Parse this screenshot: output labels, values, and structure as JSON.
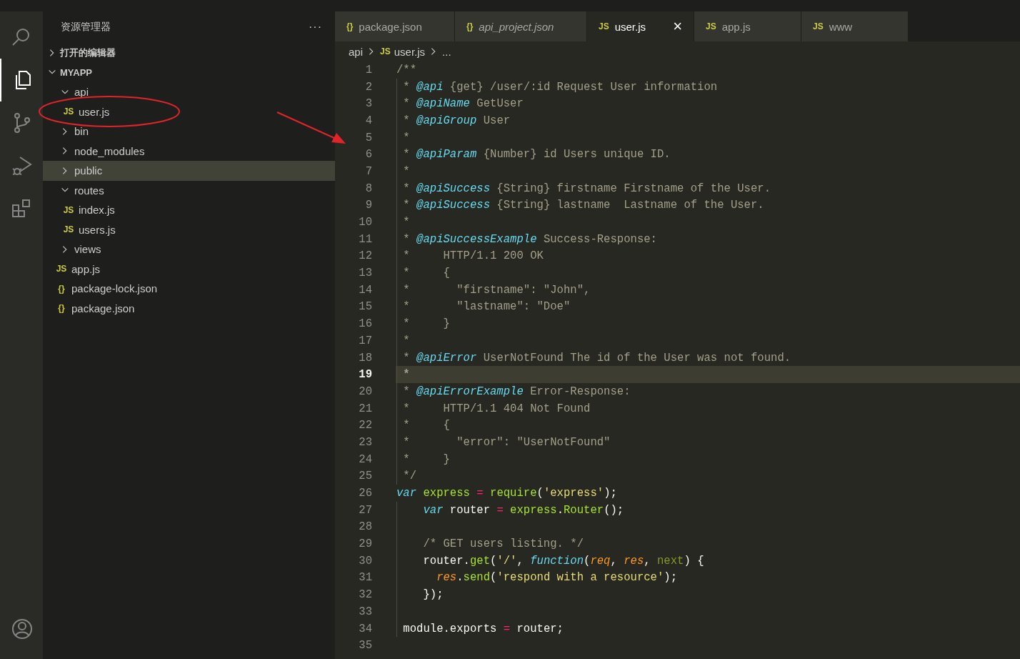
{
  "activity_bar": [
    {
      "kind": "search",
      "selected": false
    },
    {
      "kind": "explorer",
      "selected": true
    },
    {
      "kind": "source_control",
      "selected": false
    },
    {
      "kind": "run_debug",
      "selected": false
    },
    {
      "kind": "extensions",
      "selected": false
    },
    {
      "kind": "account",
      "selected": false
    }
  ],
  "sidebar": {
    "title": "资源管理器",
    "more": "···",
    "sections": [
      {
        "label": "打开的编辑器",
        "expanded": false
      },
      {
        "label": "MYAPP",
        "expanded": true
      }
    ],
    "tree": [
      {
        "kind": "folder",
        "label": "api",
        "expanded": true,
        "selected": false,
        "children": [
          {
            "kind": "file",
            "badge": "JS",
            "label": "user.js",
            "selected": false
          }
        ]
      },
      {
        "kind": "folder",
        "label": "bin",
        "expanded": false,
        "selected": false
      },
      {
        "kind": "folder",
        "label": "node_modules",
        "expanded": false,
        "selected": false
      },
      {
        "kind": "folder",
        "label": "public",
        "expanded": false,
        "selected": true
      },
      {
        "kind": "folder",
        "label": "routes",
        "expanded": true,
        "selected": false,
        "children": [
          {
            "kind": "file",
            "badge": "JS",
            "label": "index.js",
            "selected": false
          },
          {
            "kind": "file",
            "badge": "JS",
            "label": "users.js",
            "selected": false
          }
        ]
      },
      {
        "kind": "folder",
        "label": "views",
        "expanded": false,
        "selected": false
      },
      {
        "kind": "file",
        "badge": "JS",
        "label": "app.js",
        "selected": false
      },
      {
        "kind": "file",
        "badge": "{}",
        "label": "package-lock.json",
        "selected": false
      },
      {
        "kind": "file",
        "badge": "{}",
        "label": "package.json",
        "selected": false
      }
    ]
  },
  "tabs": [
    {
      "badge": "{}",
      "label": "package.json",
      "preview": false,
      "selected": false
    },
    {
      "badge": "{}",
      "label": "api_project.json",
      "preview": true,
      "selected": false
    },
    {
      "badge": "JS",
      "label": "user.js",
      "preview": false,
      "selected": true,
      "close": "×"
    },
    {
      "badge": "JS",
      "label": "app.js",
      "preview": false,
      "selected": false
    },
    {
      "badge": "JS",
      "label": "www",
      "preview": false,
      "selected": false
    }
  ],
  "breadcrumb": [
    {
      "label": "api"
    },
    {
      "badge": "JS",
      "label": "user.js"
    },
    {
      "label": "..."
    }
  ],
  "editor": {
    "lines": [
      {
        "number": "1",
        "current": false,
        "tokens": [
          {
            "kind": "comment",
            "text": "/**"
          }
        ]
      },
      {
        "number": "2",
        "current": false,
        "tokens": [
          {
            "kind": "comment",
            "text": " * "
          },
          {
            "kind": "tag",
            "text": "@api"
          },
          {
            "kind": "comment",
            "text": " {get} /user/:id Request User information"
          }
        ]
      },
      {
        "number": "3",
        "current": false,
        "tokens": [
          {
            "kind": "comment",
            "text": " * "
          },
          {
            "kind": "tag",
            "text": "@apiName"
          },
          {
            "kind": "comment",
            "text": " GetUser"
          }
        ]
      },
      {
        "number": "4",
        "current": false,
        "tokens": [
          {
            "kind": "comment",
            "text": " * "
          },
          {
            "kind": "tag",
            "text": "@apiGroup"
          },
          {
            "kind": "comment",
            "text": " User"
          }
        ]
      },
      {
        "number": "5",
        "current": false,
        "tokens": [
          {
            "kind": "comment",
            "text": " *"
          }
        ]
      },
      {
        "number": "6",
        "current": false,
        "tokens": [
          {
            "kind": "comment",
            "text": " * "
          },
          {
            "kind": "tag",
            "text": "@apiParam"
          },
          {
            "kind": "comment",
            "text": " {Number} id Users unique ID."
          }
        ]
      },
      {
        "number": "7",
        "current": false,
        "tokens": [
          {
            "kind": "comment",
            "text": " *"
          }
        ]
      },
      {
        "number": "8",
        "current": false,
        "tokens": [
          {
            "kind": "comment",
            "text": " * "
          },
          {
            "kind": "tag",
            "text": "@apiSuccess"
          },
          {
            "kind": "comment",
            "text": " {String} firstname Firstname of the User."
          }
        ]
      },
      {
        "number": "9",
        "current": false,
        "tokens": [
          {
            "kind": "comment",
            "text": " * "
          },
          {
            "kind": "tag",
            "text": "@apiSuccess"
          },
          {
            "kind": "comment",
            "text": " {String} lastname  Lastname of the User."
          }
        ]
      },
      {
        "number": "10",
        "current": false,
        "tokens": [
          {
            "kind": "comment",
            "text": " *"
          }
        ]
      },
      {
        "number": "11",
        "current": false,
        "tokens": [
          {
            "kind": "comment",
            "text": " * "
          },
          {
            "kind": "tag",
            "text": "@apiSuccessExample"
          },
          {
            "kind": "comment",
            "text": " Success-Response:"
          }
        ]
      },
      {
        "number": "12",
        "current": false,
        "tokens": [
          {
            "kind": "comment",
            "text": " *     HTTP/1.1 200 OK"
          }
        ]
      },
      {
        "number": "13",
        "current": false,
        "tokens": [
          {
            "kind": "comment",
            "text": " *     {"
          }
        ]
      },
      {
        "number": "14",
        "current": false,
        "tokens": [
          {
            "kind": "comment",
            "text": " *       \"firstname\": \"John\","
          }
        ]
      },
      {
        "number": "15",
        "current": false,
        "tokens": [
          {
            "kind": "comment",
            "text": " *       \"lastname\": \"Doe\""
          }
        ]
      },
      {
        "number": "16",
        "current": false,
        "tokens": [
          {
            "kind": "comment",
            "text": " *     }"
          }
        ]
      },
      {
        "number": "17",
        "current": false,
        "tokens": [
          {
            "kind": "comment",
            "text": " *"
          }
        ]
      },
      {
        "number": "18",
        "current": false,
        "tokens": [
          {
            "kind": "comment",
            "text": " * "
          },
          {
            "kind": "tag",
            "text": "@apiError"
          },
          {
            "kind": "comment",
            "text": " UserNotFound The id of the User was not found."
          }
        ]
      },
      {
        "number": "19",
        "current": true,
        "tokens": [
          {
            "kind": "comment",
            "text": " *"
          }
        ]
      },
      {
        "number": "20",
        "current": false,
        "tokens": [
          {
            "kind": "comment",
            "text": " * "
          },
          {
            "kind": "tag",
            "text": "@apiErrorExample"
          },
          {
            "kind": "comment",
            "text": " Error-Response:"
          }
        ]
      },
      {
        "number": "21",
        "current": false,
        "tokens": [
          {
            "kind": "comment",
            "text": " *     HTTP/1.1 404 Not Found"
          }
        ]
      },
      {
        "number": "22",
        "current": false,
        "tokens": [
          {
            "kind": "comment",
            "text": " *     {"
          }
        ]
      },
      {
        "number": "23",
        "current": false,
        "tokens": [
          {
            "kind": "comment",
            "text": " *       \"error\": \"UserNotFound\""
          }
        ]
      },
      {
        "number": "24",
        "current": false,
        "tokens": [
          {
            "kind": "comment",
            "text": " *     }"
          }
        ]
      },
      {
        "number": "25",
        "current": false,
        "tokens": [
          {
            "kind": "comment",
            "text": " */"
          }
        ]
      },
      {
        "number": "26",
        "current": false,
        "tokens": [
          {
            "kind": "keyword",
            "text": "var"
          },
          {
            "kind": "definition",
            "text": " express"
          },
          {
            "kind": "operator",
            "text": " ="
          },
          {
            "kind": "function",
            "text": " require"
          },
          {
            "kind": "plain",
            "text": "("
          },
          {
            "kind": "string",
            "text": "'express'"
          },
          {
            "kind": "plain",
            "text": ");"
          }
        ]
      },
      {
        "number": "27",
        "current": false,
        "tokens": [
          {
            "kind": "keyword",
            "text": "    var"
          },
          {
            "kind": "plain",
            "text": " router"
          },
          {
            "kind": "operator",
            "text": " ="
          },
          {
            "kind": "definition",
            "text": " express"
          },
          {
            "kind": "plain",
            "text": "."
          },
          {
            "kind": "function",
            "text": "Router"
          },
          {
            "kind": "plain",
            "text": "();"
          }
        ]
      },
      {
        "number": "28",
        "current": false
      },
      {
        "number": "29",
        "current": false,
        "tokens": [
          {
            "kind": "comment",
            "text": "    /* GET users listing. */"
          }
        ]
      },
      {
        "number": "30",
        "current": false,
        "tokens": [
          {
            "kind": "plain",
            "text": "    router."
          },
          {
            "kind": "function",
            "text": "get"
          },
          {
            "kind": "plain",
            "text": "("
          },
          {
            "kind": "string",
            "text": "'/'"
          },
          {
            "kind": "plain",
            "text": ","
          },
          {
            "kind": "keyword",
            "text": " function"
          },
          {
            "kind": "plain",
            "text": "("
          },
          {
            "kind": "parameter",
            "text": "req"
          },
          {
            "kind": "plain",
            "text": ","
          },
          {
            "kind": "parameter",
            "text": " res"
          },
          {
            "kind": "plain",
            "text": ","
          },
          {
            "kind": "unused",
            "text": " next"
          },
          {
            "kind": "plain",
            "text": ") {"
          }
        ]
      },
      {
        "number": "31",
        "current": false,
        "tokens": [
          {
            "kind": "parameter",
            "text": "      res"
          },
          {
            "kind": "plain",
            "text": "."
          },
          {
            "kind": "function",
            "text": "send"
          },
          {
            "kind": "plain",
            "text": "("
          },
          {
            "kind": "string",
            "text": "'respond with a resource'"
          },
          {
            "kind": "plain",
            "text": ");"
          }
        ]
      },
      {
        "number": "32",
        "current": false,
        "tokens": [
          {
            "kind": "plain",
            "text": "    });"
          }
        ]
      },
      {
        "number": "33",
        "current": false
      },
      {
        "number": "34",
        "current": false,
        "tokens": [
          {
            "kind": "plain",
            "text": " module.exports"
          },
          {
            "kind": "operator",
            "text": " ="
          },
          {
            "kind": "plain",
            "text": " router;"
          }
        ]
      },
      {
        "number": "35",
        "current": false
      }
    ]
  }
}
